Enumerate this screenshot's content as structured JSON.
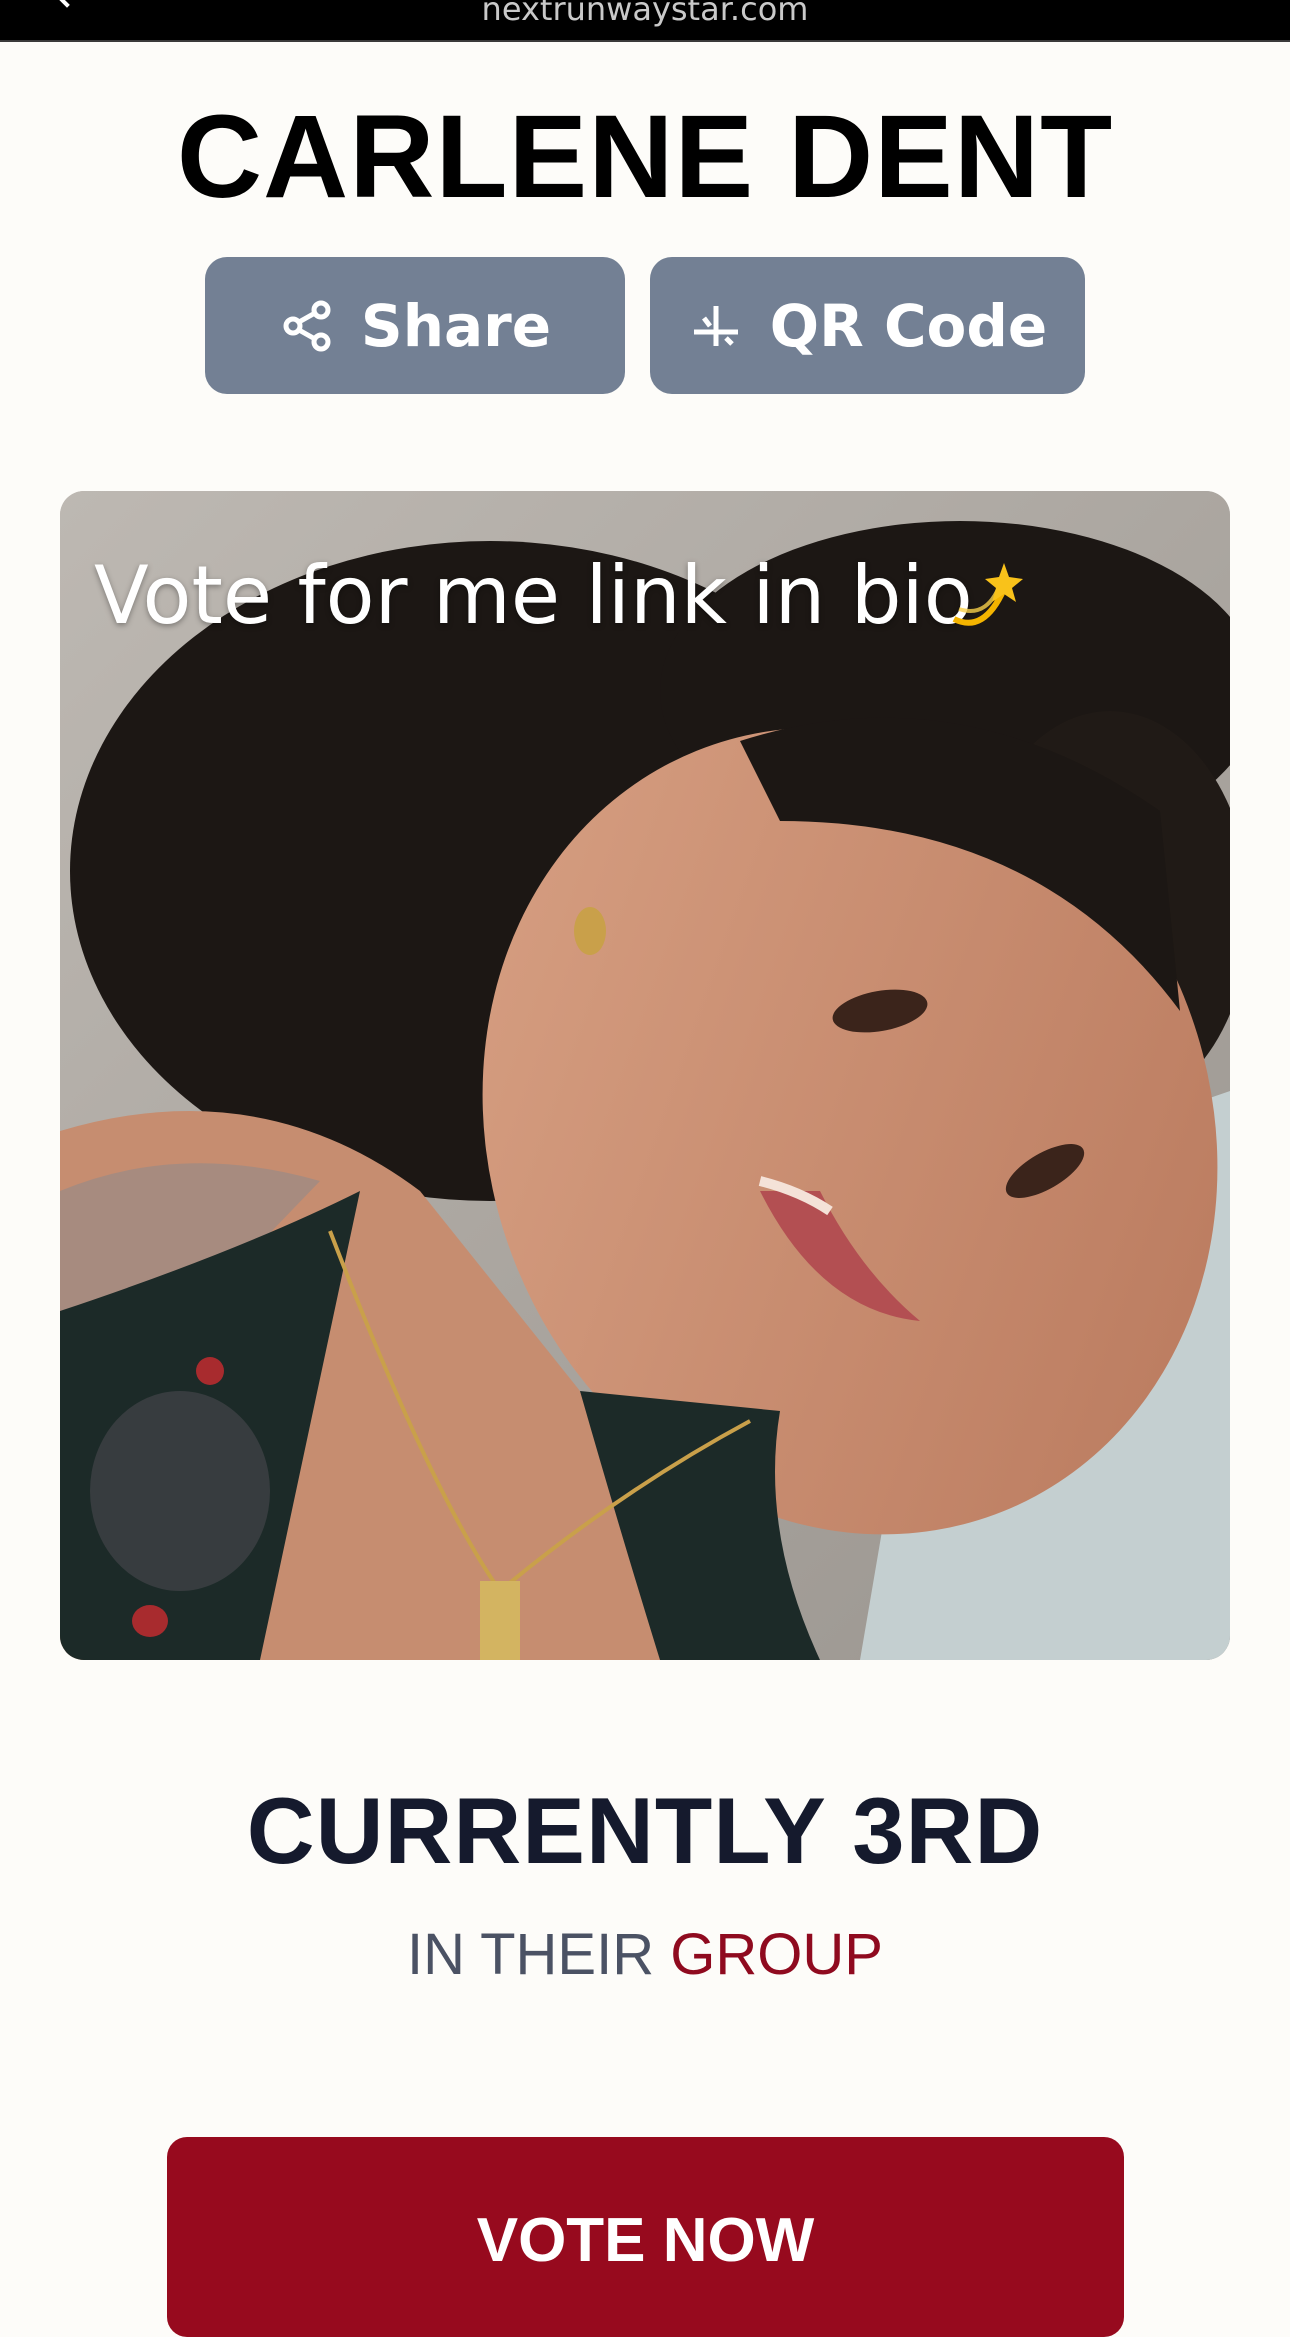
{
  "browser": {
    "url": "nextrunwaystar.com"
  },
  "profile": {
    "name": "CARLENE DENT"
  },
  "actions": {
    "share_label": "Share",
    "qr_label": "QR Code"
  },
  "photo": {
    "caption": "Vote for me link in bio",
    "caption_emoji": "dizzy-emoji"
  },
  "standing": {
    "rank_text": "CURRENTLY 3RD",
    "sub_prefix": "IN THEIR",
    "sub_accent": "GROUP"
  },
  "cta": {
    "vote_label": "VOTE NOW"
  },
  "colors": {
    "button_gray": "#738094",
    "brand_red": "#970a1e",
    "accent_red": "#8f0a1f",
    "heading_navy": "#151a2d"
  }
}
